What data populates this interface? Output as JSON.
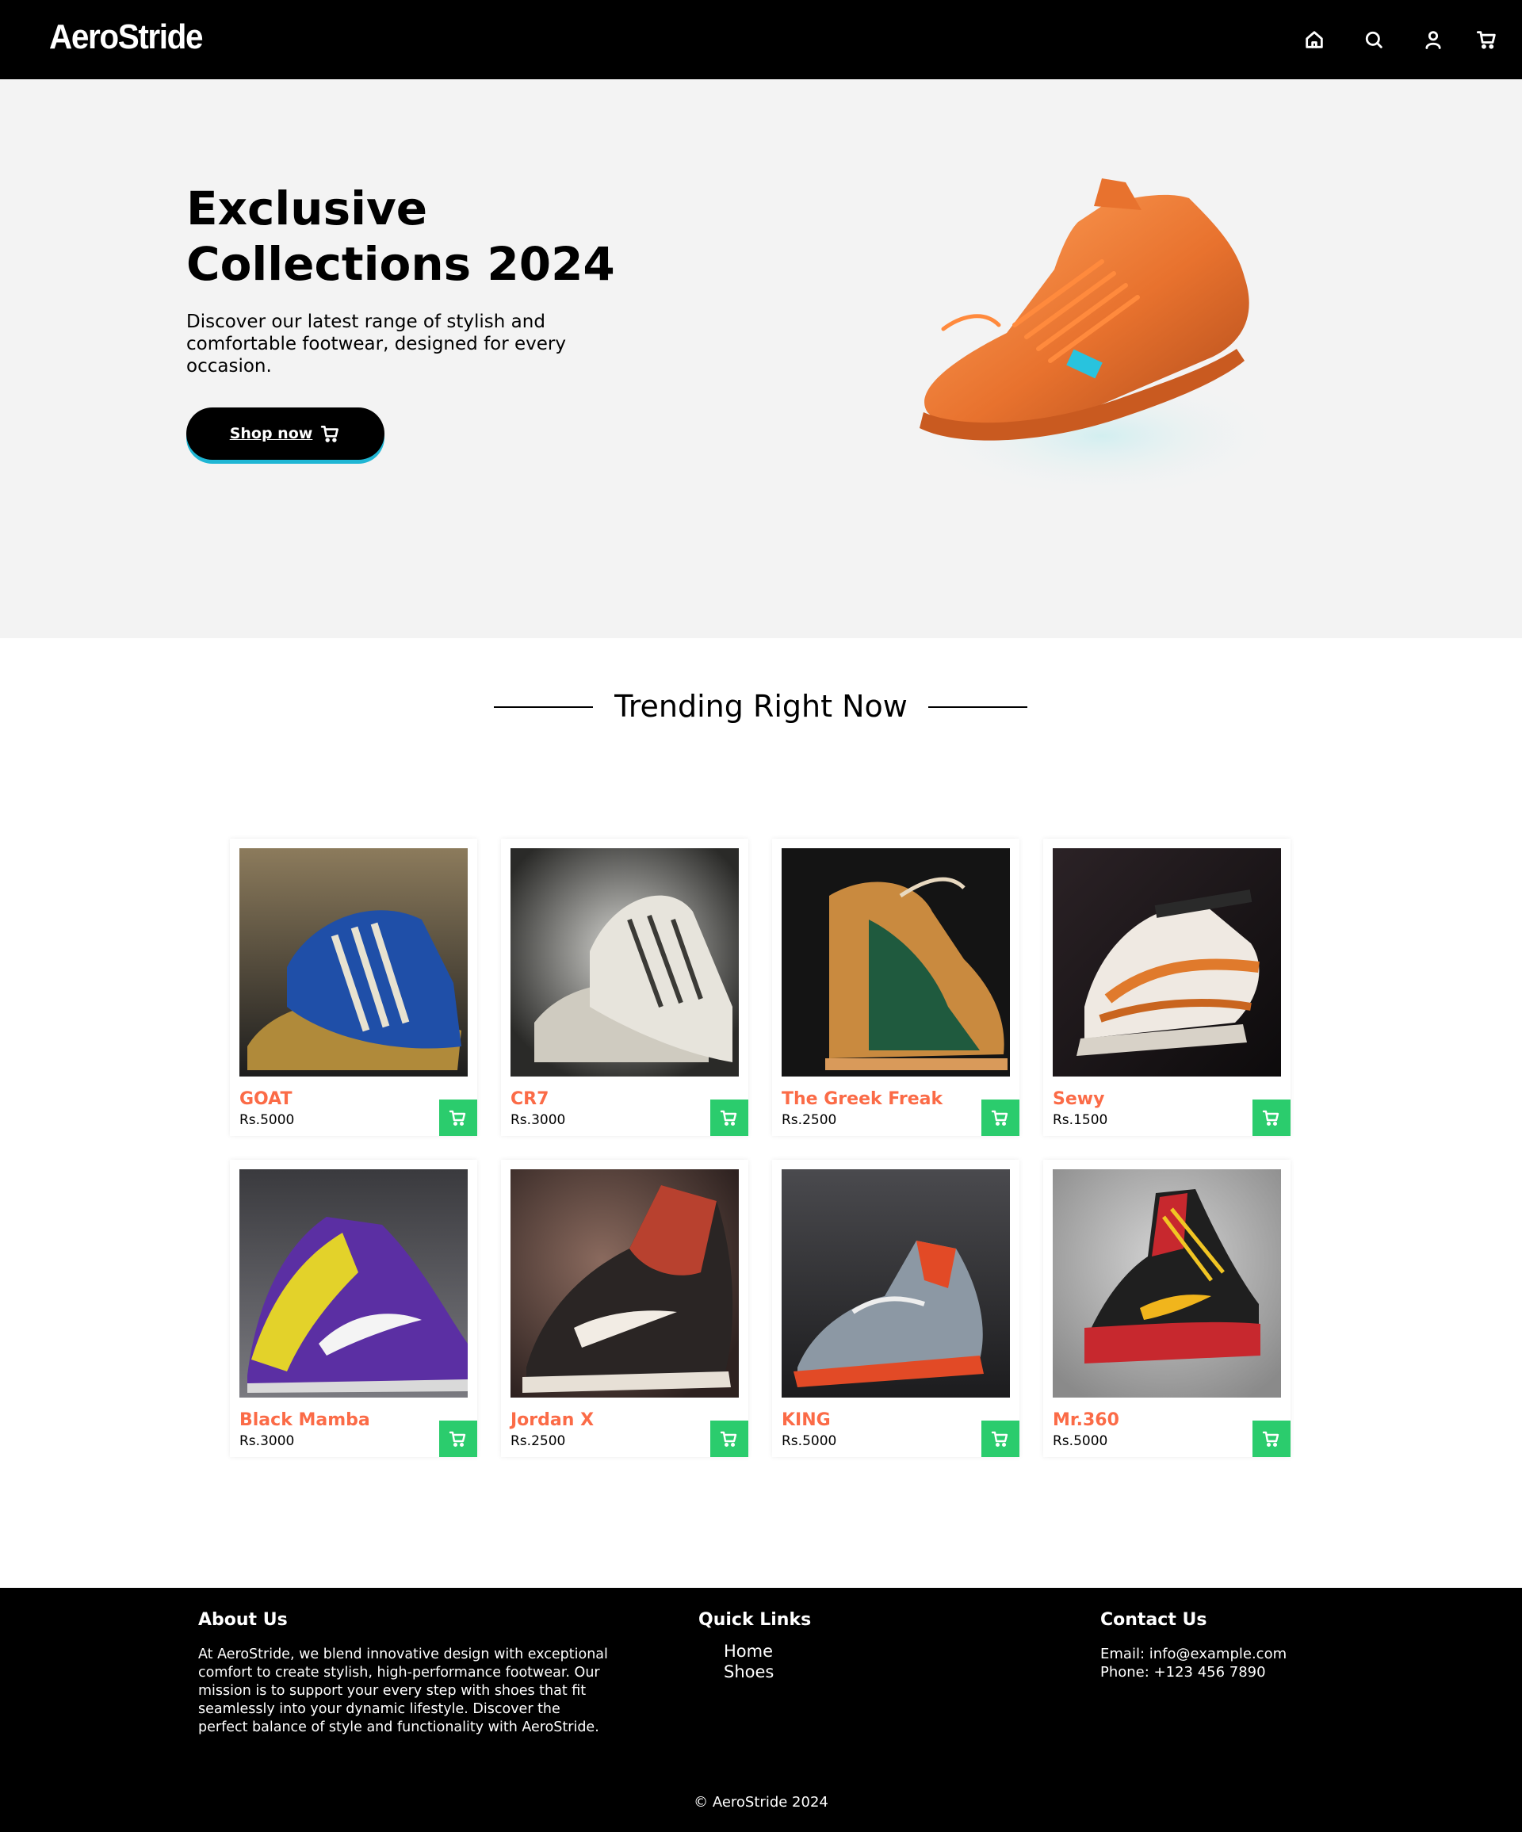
{
  "brand": {
    "name": "AeroStride"
  },
  "nav": {
    "icons": [
      "home-icon",
      "search-icon",
      "user-icon",
      "cart-icon"
    ]
  },
  "hero": {
    "title": "Exclusive Collections 2024",
    "description": "Discover our latest range of stylish and comfortable footwear, designed for every occasion.",
    "cta_label": "Shop now"
  },
  "trending": {
    "title": "Trending Right Now",
    "products": [
      {
        "name": "GOAT",
        "price": "Rs.5000"
      },
      {
        "name": "CR7",
        "price": "Rs.3000"
      },
      {
        "name": "The Greek Freak",
        "price": "Rs.2500"
      },
      {
        "name": "Sewy",
        "price": "Rs.1500"
      },
      {
        "name": "Black Mamba",
        "price": "Rs.3000"
      },
      {
        "name": "Jordan X",
        "price": "Rs.2500"
      },
      {
        "name": "KING",
        "price": "Rs.5000"
      },
      {
        "name": "Mr.360",
        "price": "Rs.5000"
      }
    ]
  },
  "footer": {
    "about_title": "About Us",
    "about_text": "At AeroStride, we blend innovative design with exceptional comfort to create stylish, high-performance footwear. Our mission is to support your every step with shoes that fit seamlessly into your dynamic lifestyle. Discover the perfect balance of style and functionality with AeroStride.",
    "links_title": "Quick Links",
    "links": [
      "Home",
      "Shoes"
    ],
    "contact_title": "Contact Us",
    "email": "Email: info@example.com",
    "phone": "Phone: +123 456 7890",
    "copyright": "©  AeroStride 2024"
  },
  "colors": {
    "accent_green": "#2bcc6d",
    "product_name": "#fb6b47",
    "cta_underline": "#1fb6d4",
    "hero_bg": "#f3f3f3"
  }
}
